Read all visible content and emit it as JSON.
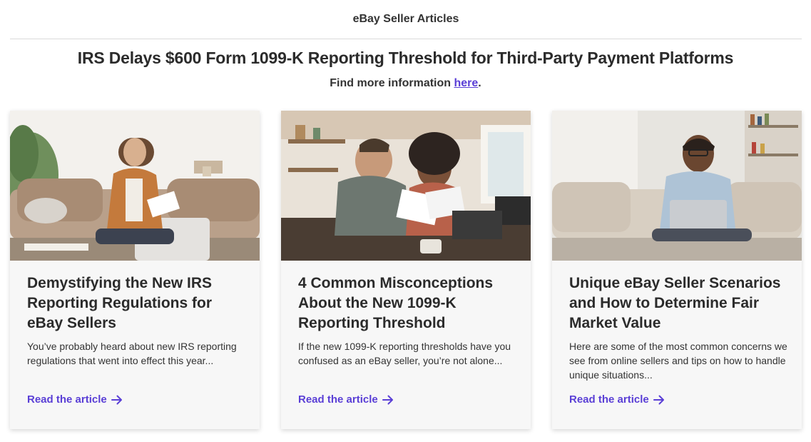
{
  "header": {
    "title": "eBay Seller Articles"
  },
  "banner": {
    "headline": "IRS Delays $600 Form 1099-K Reporting Threshold for Third-Party Payment Platforms",
    "subline_prefix": "Find more information ",
    "subline_link": "here",
    "subline_suffix": "."
  },
  "colors": {
    "accent": "#5a3fd6",
    "card_bg": "#f7f7f7",
    "text": "#2b2b2b"
  },
  "cards": [
    {
      "title": "Demystifying the New IRS Reporting Regulations for eBay Sellers",
      "description": "You’ve probably heard about new IRS reporting regulations that went into effect this year...",
      "link": "Read the article",
      "icon": "arrow-right-icon"
    },
    {
      "title": "4 Common Misconceptions About the New 1099-K Reporting Threshold",
      "description": "If the new 1099-K reporting thresholds have you confused as an eBay seller, you’re not alone...",
      "link": "Read the article",
      "icon": "arrow-right-icon"
    },
    {
      "title": "Unique eBay Seller Scenarios and How to Determine Fair Market Value",
      "description": "Here are some of the most common concerns we see from online sellers and tips on how to handle unique situations...",
      "link": "Read the article",
      "icon": "arrow-right-icon"
    }
  ]
}
